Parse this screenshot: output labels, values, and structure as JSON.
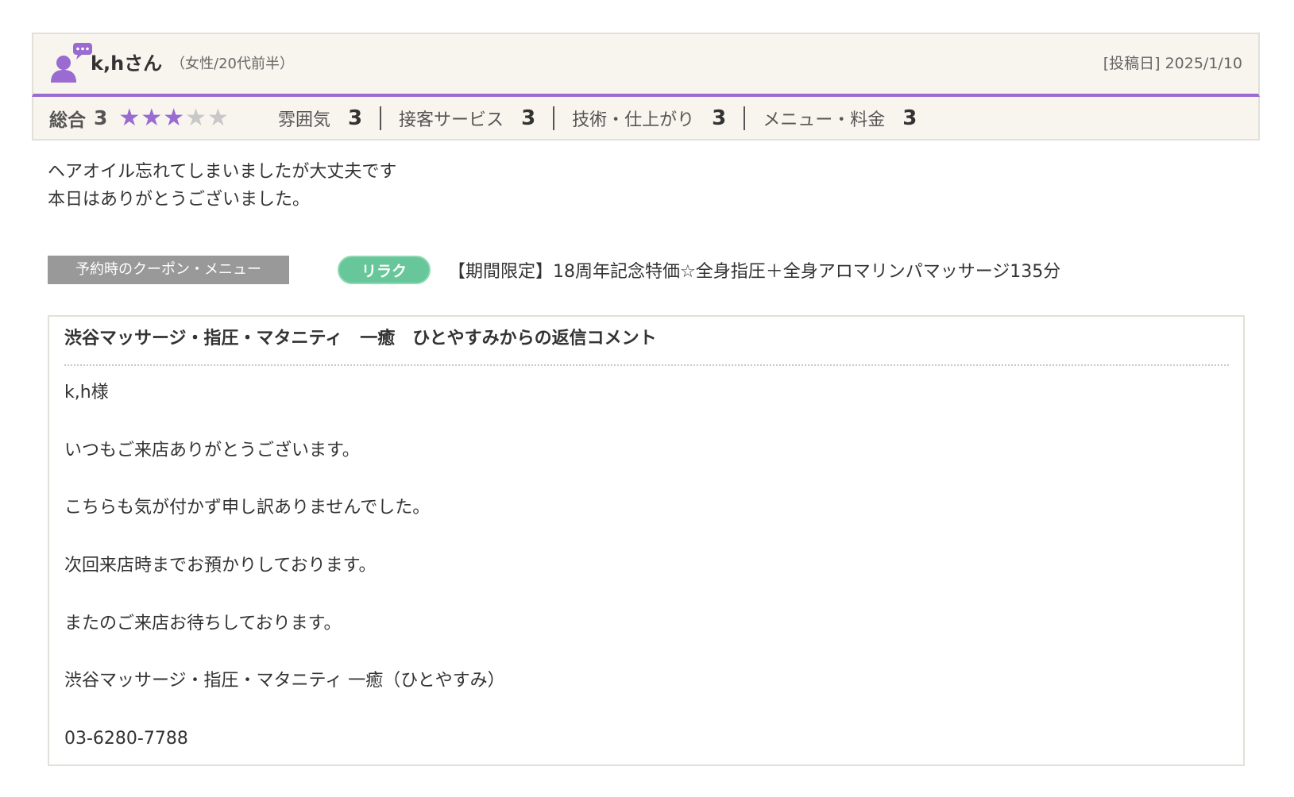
{
  "review": {
    "user_name": "k,hさん",
    "user_meta": "（女性/20代前半）",
    "post_date": "[投稿日] 2025/1/10",
    "overall_label": "総合",
    "overall_value": "3",
    "stars": {
      "filled": 3,
      "total": 5
    },
    "colors": {
      "accent": "#9a6bd0",
      "header_bg": "#f8f5ee",
      "tag_green": "#67c79a"
    },
    "categories": [
      {
        "label": "雰囲気",
        "value": "3"
      },
      {
        "label": "接客サービス",
        "value": "3"
      },
      {
        "label": "技術・仕上がり",
        "value": "3"
      },
      {
        "label": "メニュー・料金",
        "value": "3"
      }
    ],
    "body_lines": [
      "ヘアオイル忘れてしまいましたが大丈夫です",
      "本日はありがとうございました。"
    ],
    "coupon": {
      "label": "予約時のクーポン・メニュー",
      "tag": "リラク",
      "name": "【期間限定】18周年記念特価☆全身指圧＋全身アロマリンパマッサージ135分"
    }
  },
  "reply": {
    "title": "渋谷マッサージ・指圧・マタニティ　一癒　ひとやすみからの返信コメント",
    "lines": [
      "k,h様",
      "いつもご来店ありがとうございます。",
      "こちらも気が付かず申し訳ありませんでした。",
      "次回来店時までお預かりしております。",
      "またのご来店お待ちしております。",
      "渋谷マッサージ・指圧・マタニティ 一癒（ひとやすみ）",
      "03-6280-7788"
    ]
  },
  "icons": {
    "avatar": "user-comment-icon",
    "star": "star-icon"
  }
}
